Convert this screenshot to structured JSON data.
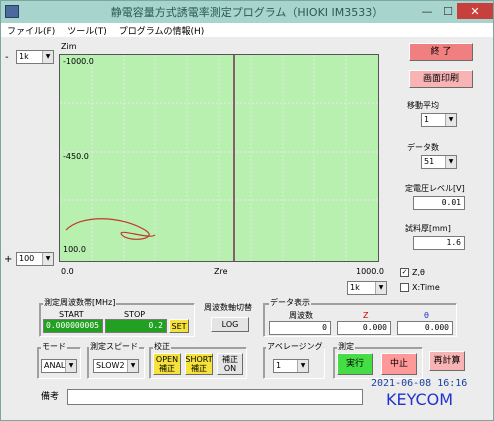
{
  "window": {
    "title": "静電容量方式誘電率測定プログラム（HIOKI IM3533）",
    "minimize_glyph": "—",
    "maximize_glyph": "☐",
    "close_glyph": "✕"
  },
  "menu": [
    "ファイル(F)",
    "ツール(T)",
    "プログラムの情報(H)"
  ],
  "left_axis": {
    "minus_sign": "-",
    "top_select": "1k",
    "plus_sign": "+",
    "bottom_select": "100"
  },
  "plot": {
    "y_label": "Zim",
    "y_ticks": [
      "-1000.0",
      "-450.0",
      "100.0"
    ],
    "x_label": "Zre",
    "x_tick_left": "0.0",
    "x_tick_right": "1000.0",
    "x_range_select": "1k"
  },
  "right_panel": {
    "end_button": "終 了",
    "print_button": "画面印刷",
    "moving_avg_label": "移動平均",
    "moving_avg_value": "1",
    "data_count_label": "データ数",
    "data_count_value": "51",
    "voltage_label": "定電圧レベル[V]",
    "voltage_value": "0.01",
    "thickness_label": "試料厚[mm]",
    "thickness_value": "1.6"
  },
  "radios": {
    "z_theta": "Z,θ",
    "x_time": "X:Time"
  },
  "freq_band": {
    "title": "測定周波数帯[MHz]",
    "start_label": "START",
    "stop_label": "STOP",
    "start_value": "0.000000005",
    "stop_value": "0.2",
    "set_button": "SET"
  },
  "freq_axis": {
    "title": "周波数軸切替",
    "button": "LOG"
  },
  "data_display": {
    "title": "データ表示",
    "freq_label": "周波数",
    "z_label": "Z",
    "theta_label": "θ",
    "freq_value": "0",
    "z_value": "0.000",
    "theta_value": "0.000"
  },
  "mode": {
    "title": "モード",
    "value": "ANAL"
  },
  "speed": {
    "title": "測定スピード",
    "value": "SLOW2"
  },
  "calib": {
    "title": "校正",
    "open_button": "OPEN\n補正",
    "short_button": "SHORT\n補正",
    "corr_button": "補正\nON"
  },
  "averaging": {
    "title": "アベレージング",
    "value": "1"
  },
  "measure": {
    "title": "測定",
    "run_button": "実行",
    "stop_button": "中止",
    "recalc_button": "再計算"
  },
  "datetime": "2021-06-08 16:16",
  "notes_label": "備考",
  "notes_value": "",
  "logo": "KEYCOM",
  "colors": {
    "plot_bg": "#b8f0b0",
    "grid": "#e8e8e8",
    "curve": "#c0392b",
    "cursor": "#7a2a5a",
    "end_button": "#f08080",
    "print_button": "#f8b4b4",
    "set_button": "#f5e23a",
    "start_field": "#22a022",
    "run_button": "#44dd44",
    "stop_button": "#ff9999",
    "recalc_button": "#f8b4b4",
    "calib_buttons": "#f5e23a",
    "logo": "#2233cc",
    "datetime": "#1a3fa0"
  }
}
